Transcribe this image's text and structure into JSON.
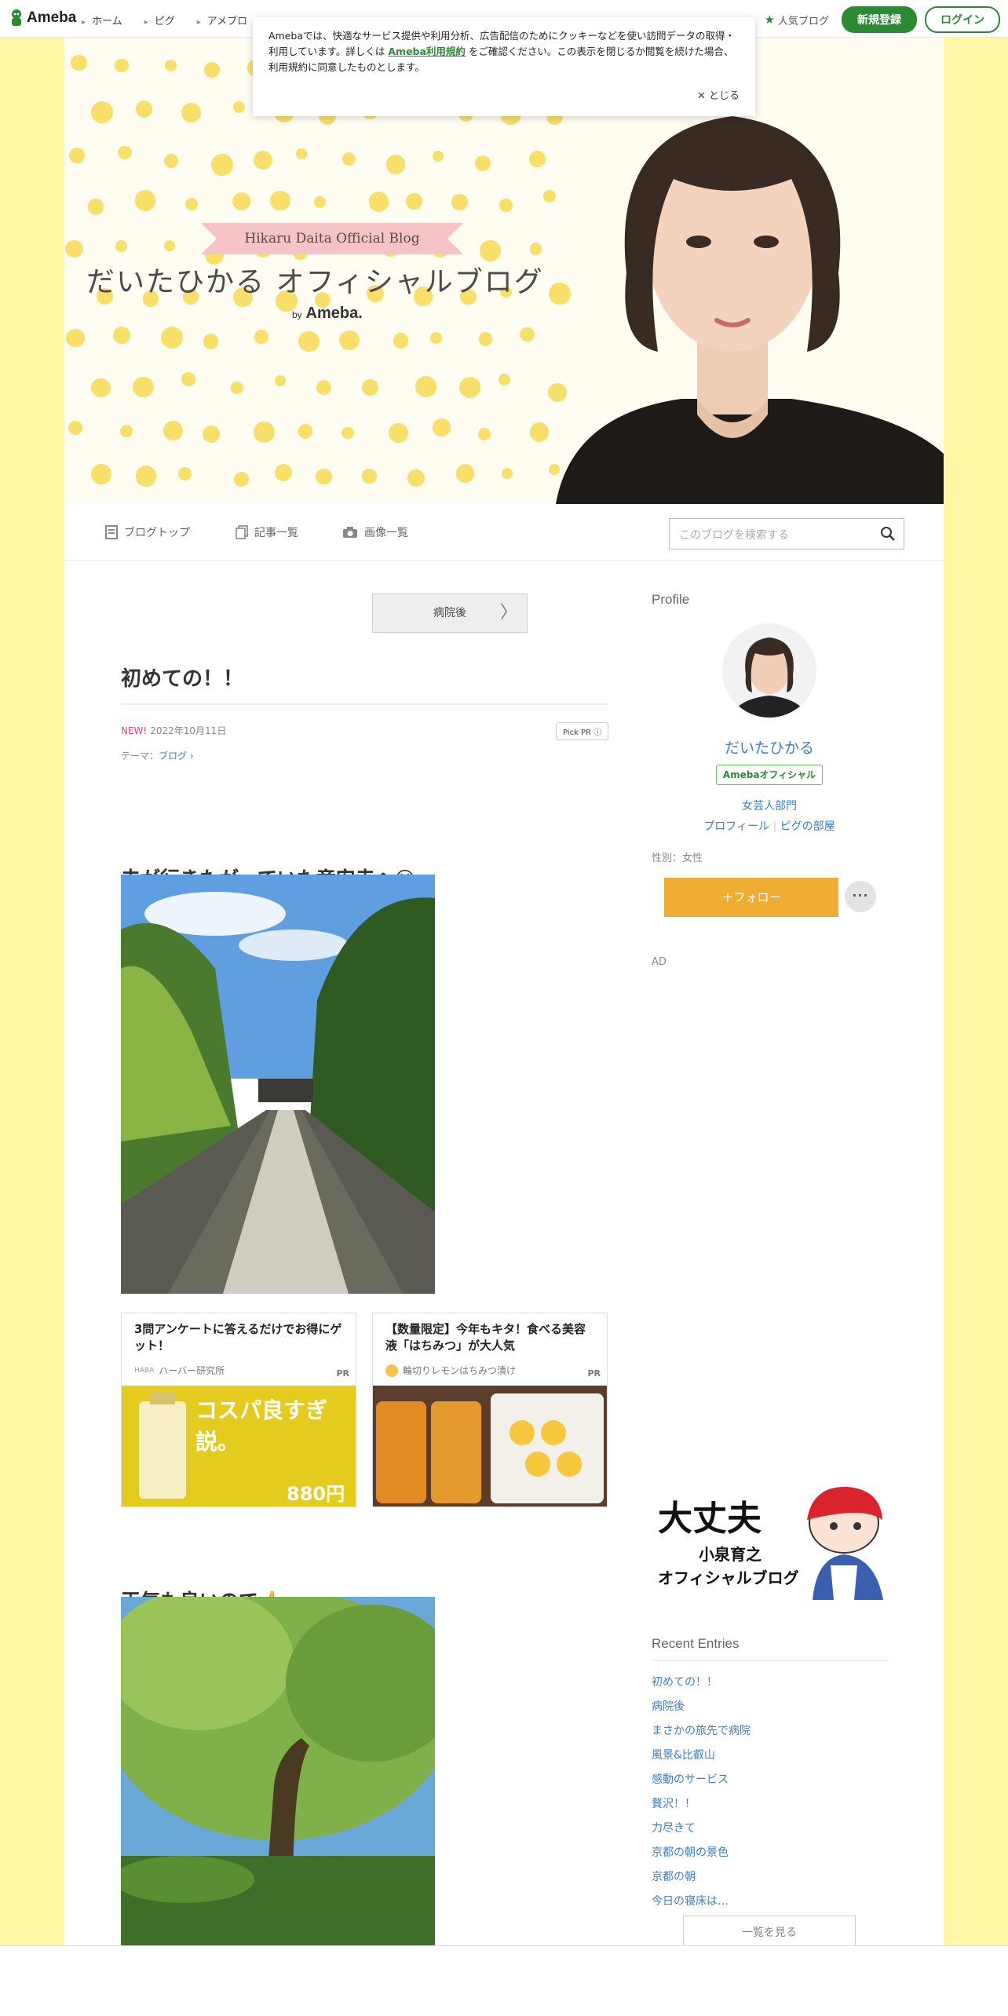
{
  "gnav": {
    "logo": "Ameba",
    "links": [
      "ホーム",
      "ピグ",
      "アメブロ"
    ],
    "popular": "人気ブログ",
    "register": "新規登録",
    "login": "ログイン"
  },
  "cookie": {
    "text_before": "Amebaでは、快適なサービス提供や利用分析、広告配信のためにクッキーなどを使い訪問データの取得・利用しています。詳しくは",
    "link": "Ameba利用規約",
    "text_after": "をご確認ください。この表示を閉じるか閲覧を続けた場合、利用規約に同意したものとします。",
    "close": "とじる"
  },
  "banner": {
    "ribbon": "Hikaru Daita Official Blog",
    "title": "だいたひかる オフィシャルブログ",
    "by": "by",
    "by_brand": "Ameba."
  },
  "blognav": {
    "top": "ブログトップ",
    "list": "記事一覧",
    "images": "画像一覧",
    "search_placeholder": "このブログを検索する"
  },
  "article": {
    "prev": "病院後",
    "title": "初めての！！",
    "new": "NEW!",
    "date": "2022年10月11日",
    "pickpr": "Pick PR ⓘ",
    "theme_label": "テーマ：",
    "theme": "ブログ",
    "heading1": "夫が行きたがっていた竜安寺へ",
    "heading2": "天気も良いので"
  },
  "ads": [
    {
      "title": "3問アンケートに答えるだけでお得にゲット！",
      "source": "ハーバー研究所",
      "pr": "PR",
      "headline": "コスパ良すぎ説。",
      "price": "880円"
    },
    {
      "title": "【数量限定】今年もキタ！食べる美容液「はちみつ」が大人気",
      "source": "輪切りレモンはちみつ漬け",
      "pr": "PR"
    }
  ],
  "sidebar": {
    "profile_heading": "Profile",
    "name": "だいたひかる",
    "official": "Amebaオフィシャル",
    "category": "女芸人部門",
    "profile_link": "プロフィール",
    "pig_link": "ピグの部屋",
    "gender": "性別：女性",
    "follow": "＋フォロー",
    "more": "···",
    "ad": "AD",
    "side_ad_text1": "大丈夫",
    "side_ad_text2": "小泉育之",
    "side_ad_text3": "オフィシャルブログ",
    "recent_heading": "Recent Entries",
    "entries": [
      "初めての！！",
      "病院後",
      "まさかの旅先で病院",
      "風景&比叡山",
      "感動のサービス",
      "贅沢！！",
      "力尽きて",
      "京都の朝の景色",
      "京都の朝",
      "今日の寝床は…"
    ],
    "see_all": "一覧を見る"
  }
}
